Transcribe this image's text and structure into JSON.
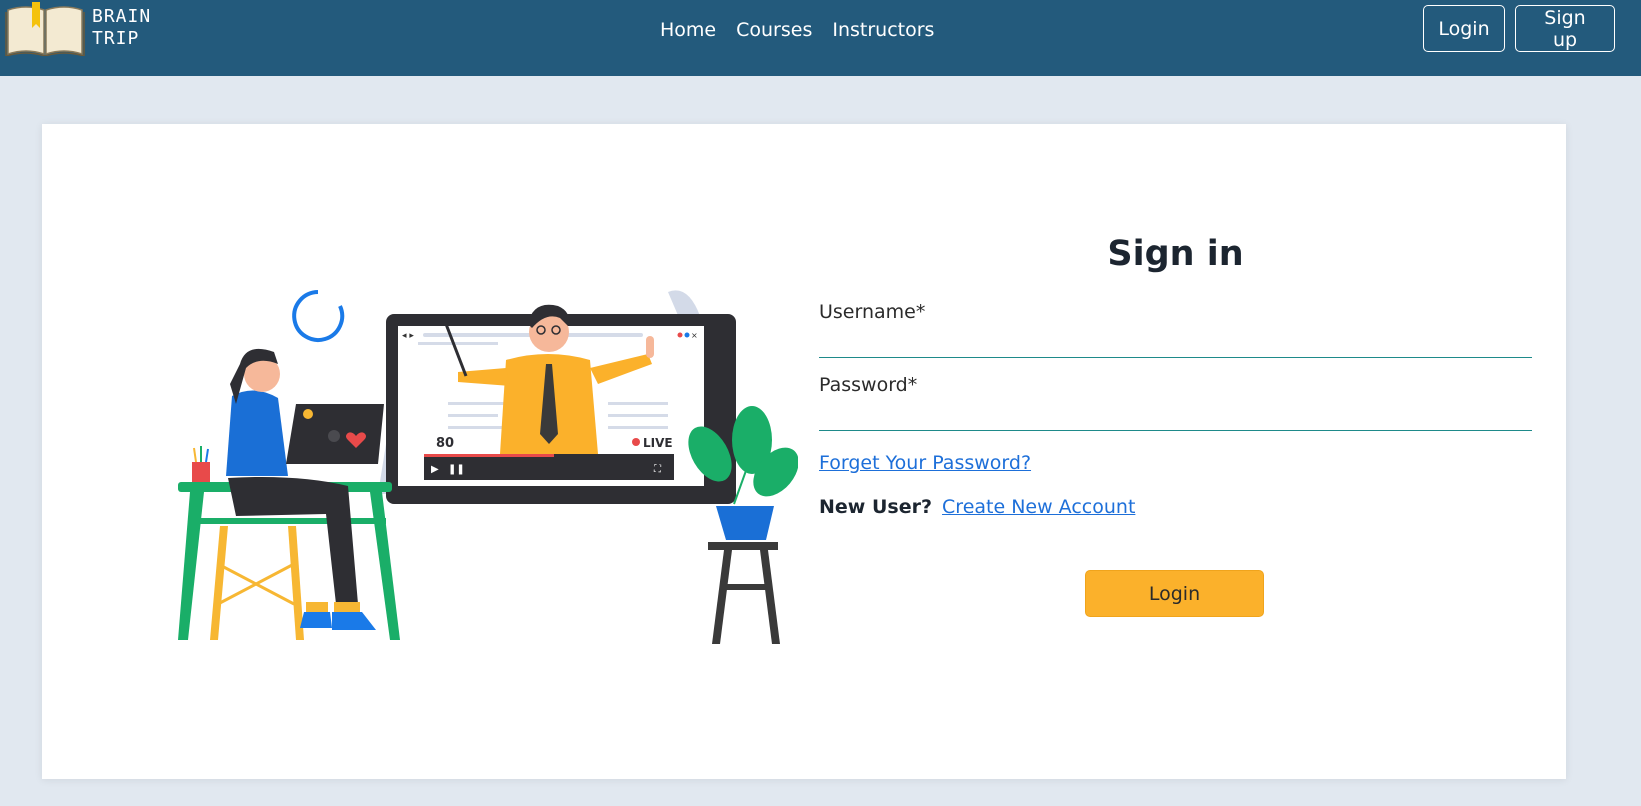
{
  "brand": {
    "line1": "BRAIN",
    "line2": "TRIP"
  },
  "nav": {
    "links": [
      "Home",
      "Courses",
      "Instructors"
    ],
    "login": "Login",
    "signup": "Sign up"
  },
  "illustration": {
    "viewer_count": "80",
    "live_label": "LIVE"
  },
  "form": {
    "title": "Sign in",
    "username_label": "Username*",
    "password_label": "Password*",
    "forgot_link": "Forget Your Password?",
    "new_user_label": "New User?",
    "create_link": "Create New Account",
    "login_button": "Login"
  },
  "colors": {
    "navbar": "#235a7c",
    "background": "#e1e8f0",
    "accent": "#fbb12b",
    "link": "#1d6fd9",
    "field_border": "#1e8a8a"
  }
}
